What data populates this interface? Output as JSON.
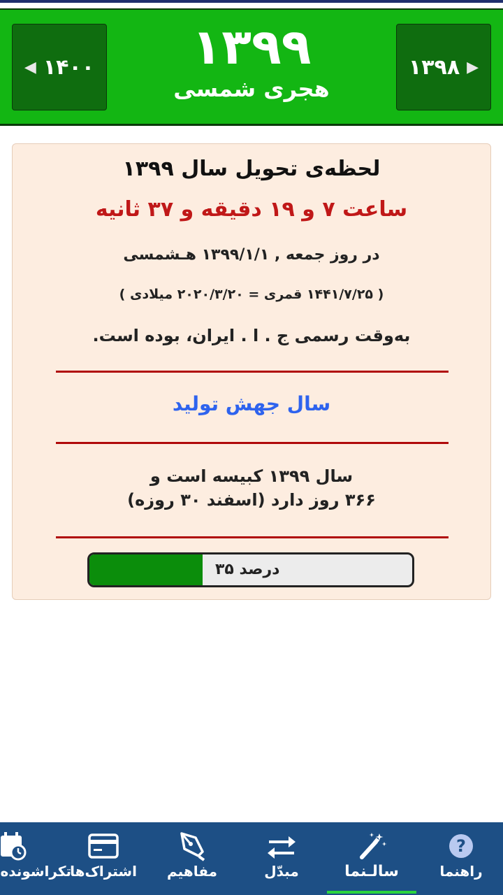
{
  "header": {
    "year": "۱۳۹۹",
    "subtitle": "هجری شمسی",
    "next_year": "۱۴۰۰",
    "prev_year": "۱۳۹۸"
  },
  "card": {
    "title": "لحظه‌ی تحویل سال ۱۳۹۹",
    "time": "ساعت ۷ و ۱۹ دقیقه و ۳۷ ثانیه",
    "date_line": "در روز جمعه , ۱۳۹۹/۱/۱ هـ‍شمسی",
    "equiv_line": "( ۱۴۴۱/۷/۲۵ قمری = ۲۰۲۰/۳/۲۰ میلادی )",
    "timezone_line": "به‌وقت رسمی ج . ا . ایران، بوده است.",
    "slogan": "سال جهش تولید",
    "leap_line1": "سال ۱۳۹۹ کبیسه است و",
    "leap_line2": "۳۶۶ روز دارد (اسفند ۳۰ روزه)",
    "progress_percent": 35,
    "progress_label": "۳۵ درصد"
  },
  "colors": {
    "header_bg": "#13b613",
    "accent_red": "#c01818",
    "slogan_blue": "#2e63ee",
    "progress_green": "#0b8d0b",
    "nav_bg": "#1d4f85"
  },
  "bottom_nav": {
    "items": [
      {
        "label": "راهنما",
        "icon": "help-icon"
      },
      {
        "label": "سالـنما",
        "icon": "magic-wand-icon",
        "active": true
      },
      {
        "label": "مبدّل",
        "icon": "swap-icon"
      },
      {
        "label": "مفاهیم",
        "icon": "pen-nib-icon"
      },
      {
        "label": "اشتراک‌ها",
        "icon": "card-icon"
      },
      {
        "label": "تکراشونده",
        "icon": "calendar-clock-icon"
      }
    ]
  }
}
